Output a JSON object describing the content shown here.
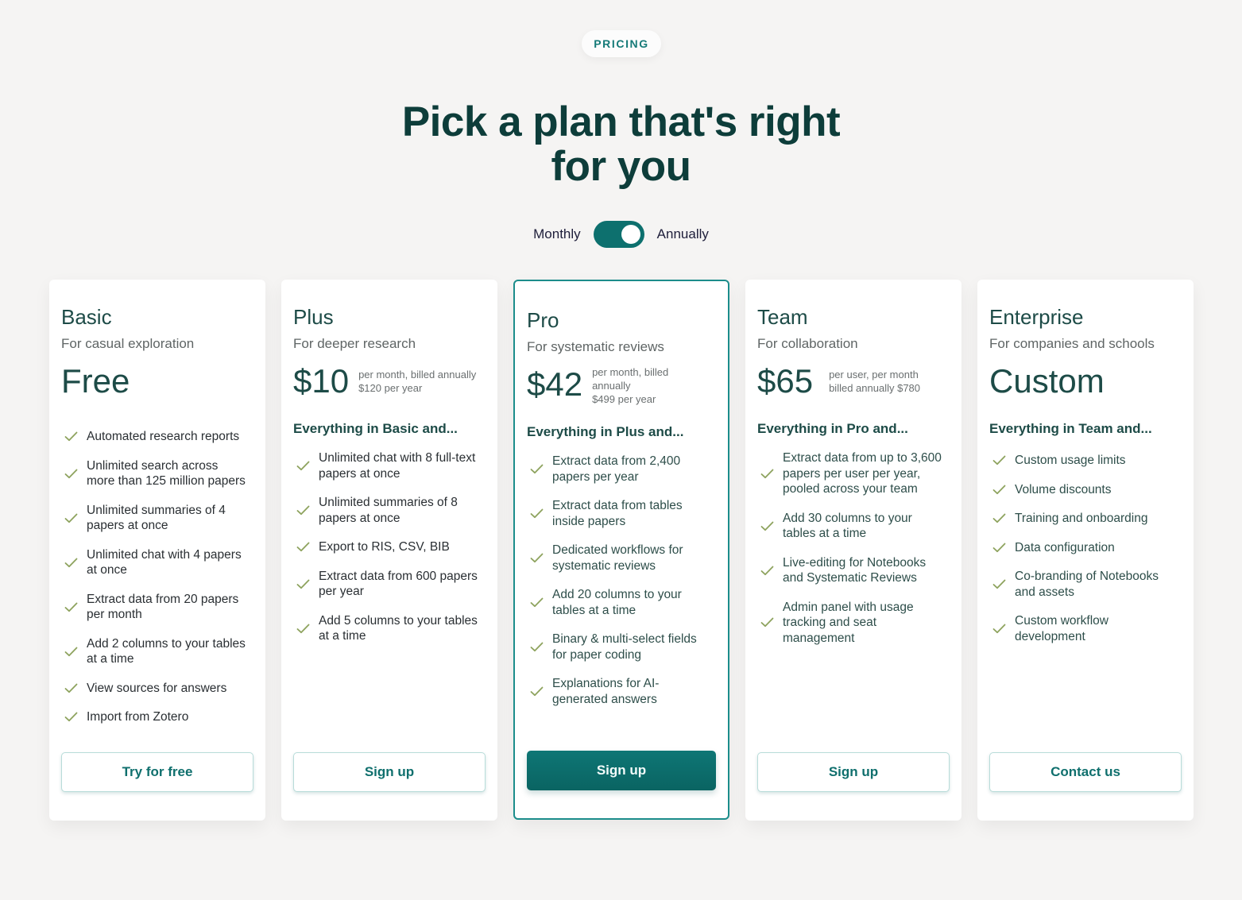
{
  "header": {
    "badge": "PRICING",
    "title_line1": "Pick a plan that's right",
    "title_line2": "for you"
  },
  "billing_toggle": {
    "left_label": "Monthly",
    "right_label": "Annually",
    "selected": "Annually"
  },
  "colors": {
    "accent": "#0d706e",
    "heading": "#0d3d3a",
    "check": "#8ea35e"
  },
  "plans": [
    {
      "name": "Basic",
      "subtitle": "For casual exploration",
      "price": "Free",
      "price_note_1": "",
      "price_note_2": "",
      "price_note_3": "",
      "everything_label": "",
      "features": [
        "Automated research reports",
        "Unlimited search across more than 125 million papers",
        "Unlimited summaries of 4 papers at once",
        "Unlimited chat with 4 papers at once",
        "Extract data from 20 papers per month",
        "Add 2 columns to your tables at a time",
        "View sources for answers",
        "Import from Zotero"
      ],
      "cta": "Try for free"
    },
    {
      "name": "Plus",
      "subtitle": "For deeper research",
      "price": "$10",
      "price_note_1": "per month, billed annually",
      "price_note_2": "$120 per year",
      "everything_label": "Everything in Basic and...",
      "features": [
        "Unlimited chat with 8 full-text papers at once",
        "Unlimited summaries of 8 papers at once",
        "Export to RIS, CSV, BIB",
        "Extract data from 600 papers per year",
        "Add 5 columns to your tables at a time"
      ],
      "cta": "Sign up"
    },
    {
      "name": "Pro",
      "subtitle": "For systematic reviews",
      "price": "$42",
      "price_note_1": "per month, billed",
      "price_note_2": "annually",
      "price_note_3": "$499 per year",
      "everything_label": "Everything in Plus and...",
      "features": [
        "Extract data from 2,400 papers per year",
        "Extract data from tables inside papers",
        "Dedicated workflows for systematic reviews",
        "Add 20 columns to your tables at a time",
        "Binary & multi-select fields for paper coding",
        "Explanations for AI-generated answers"
      ],
      "cta": "Sign up"
    },
    {
      "name": "Team",
      "subtitle": "For collaboration",
      "price": "$65",
      "price_note_1": "per user, per month",
      "price_note_2": "billed annually $780",
      "everything_label": "Everything in Pro and...",
      "features": [
        "Extract data from up to 3,600 papers per user per year, pooled  across your team",
        "Add 30 columns to your tables at a time",
        "Live-editing for Notebooks and Systematic Reviews",
        "Admin panel with usage tracking and seat management"
      ],
      "cta": "Sign up"
    },
    {
      "name": "Enterprise",
      "subtitle": "For companies and schools",
      "price": "Custom",
      "everything_label": "Everything in Team and...",
      "features": [
        "Custom usage limits",
        "Volume discounts",
        "Training and onboarding",
        "Data configuration",
        "Co-branding of Notebooks and assets",
        "Custom workflow development"
      ],
      "cta": "Contact us"
    }
  ]
}
